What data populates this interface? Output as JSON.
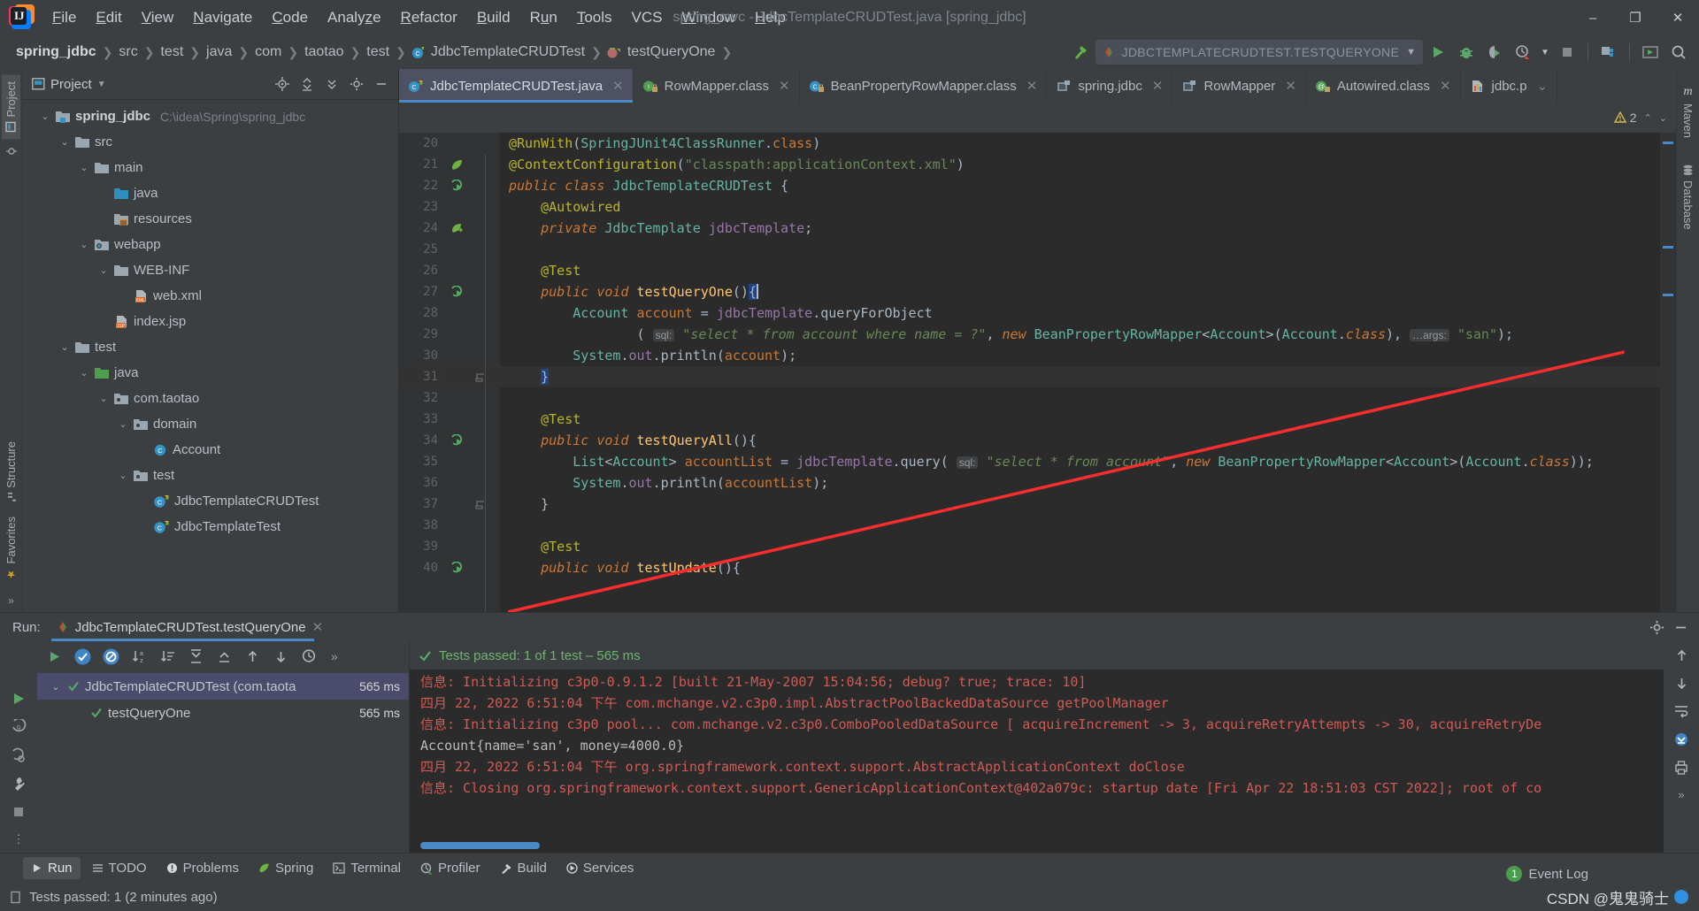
{
  "window": {
    "title": "spring_mvc - JdbcTemplateCRUDTest.java [spring_jdbc]",
    "minimize": "–",
    "maximize": "❐",
    "close": "✕"
  },
  "menu": [
    "File",
    "Edit",
    "View",
    "Navigate",
    "Code",
    "Analyze",
    "Refactor",
    "Build",
    "Run",
    "Tools",
    "VCS",
    "Window",
    "Help"
  ],
  "breadcrumb": [
    {
      "label": "spring_jdbc",
      "bold": true
    },
    {
      "label": "src",
      "bold": false
    },
    {
      "label": "test",
      "bold": false
    },
    {
      "label": "java",
      "bold": false
    },
    {
      "label": "com",
      "bold": false
    },
    {
      "label": "taotao",
      "bold": false
    },
    {
      "label": "test",
      "bold": false
    },
    {
      "label": "JdbcTemplateCRUDTest",
      "bold": false
    },
    {
      "label": "testQueryOne",
      "bold": false
    }
  ],
  "run_config": {
    "name": "JDBCTEMPLATECRUDTEST.TESTQUERYONE"
  },
  "toolbar_icons": [
    "build-hammer-icon",
    "run-icon",
    "debug-icon",
    "run-coverage-icon",
    "profiler-icon",
    "run-dropdown-icon",
    "stop-icon",
    "project-structure-icon",
    "updates-icon",
    "search-everywhere-icon"
  ],
  "project_pane": {
    "title": "Project",
    "actions": [
      "locate-icon",
      "collapse-all-icon",
      "expand-icon",
      "settings-gear-icon",
      "hide-icon"
    ],
    "tree": [
      {
        "depth": 0,
        "arrow": "down",
        "icon": "module-folder",
        "label": "spring_jdbc",
        "bold": true,
        "path": "C:\\idea\\Spring\\spring_jdbc"
      },
      {
        "depth": 1,
        "arrow": "down",
        "icon": "folder",
        "label": "src",
        "bold": false,
        "path": ""
      },
      {
        "depth": 2,
        "arrow": "down",
        "icon": "folder",
        "label": "main",
        "bold": false,
        "path": ""
      },
      {
        "depth": 3,
        "arrow": "none",
        "icon": "source-folder-blue",
        "label": "java",
        "bold": false,
        "path": ""
      },
      {
        "depth": 3,
        "arrow": "none",
        "icon": "resources-folder",
        "label": "resources",
        "bold": false,
        "path": ""
      },
      {
        "depth": 2,
        "arrow": "down",
        "icon": "webapp-folder",
        "label": "webapp",
        "bold": false,
        "path": ""
      },
      {
        "depth": 3,
        "arrow": "down",
        "icon": "folder",
        "label": "WEB-INF",
        "bold": false,
        "path": ""
      },
      {
        "depth": 4,
        "arrow": "none",
        "icon": "xml-file",
        "label": "web.xml",
        "bold": false,
        "path": ""
      },
      {
        "depth": 3,
        "arrow": "none",
        "icon": "jsp-file",
        "label": "index.jsp",
        "bold": false,
        "path": ""
      },
      {
        "depth": 1,
        "arrow": "down",
        "icon": "folder",
        "label": "test",
        "bold": false,
        "path": ""
      },
      {
        "depth": 2,
        "arrow": "down",
        "icon": "test-source-folder-green",
        "label": "java",
        "bold": false,
        "path": ""
      },
      {
        "depth": 3,
        "arrow": "down",
        "icon": "package",
        "label": "com.taotao",
        "bold": false,
        "path": ""
      },
      {
        "depth": 4,
        "arrow": "down",
        "icon": "package",
        "label": "domain",
        "bold": false,
        "path": ""
      },
      {
        "depth": 5,
        "arrow": "none",
        "icon": "class",
        "label": "Account",
        "bold": false,
        "path": ""
      },
      {
        "depth": 4,
        "arrow": "down",
        "icon": "package",
        "label": "test",
        "bold": false,
        "path": ""
      },
      {
        "depth": 5,
        "arrow": "none",
        "icon": "test-class",
        "label": "JdbcTemplateCRUDTest",
        "bold": false,
        "path": ""
      },
      {
        "depth": 5,
        "arrow": "none",
        "icon": "test-class",
        "label": "JdbcTemplateTest",
        "bold": false,
        "path": ""
      }
    ]
  },
  "left_rail": [
    {
      "label": "Project",
      "icon": "project-icon",
      "active": true
    },
    {
      "label": "",
      "icon": "commit-icon",
      "active": false
    }
  ],
  "left_rail_bottom": [
    {
      "label": "Structure",
      "icon": "structure-icon"
    },
    {
      "label": "Favorites",
      "icon": "star-icon"
    }
  ],
  "right_rail": [
    {
      "label": "Maven",
      "icon": "maven-icon"
    },
    {
      "label": "Database",
      "icon": "database-icon"
    }
  ],
  "editor_tabs": [
    {
      "label": "JdbcTemplateCRUDTest.java",
      "icon": "test-class-icon",
      "active": true
    },
    {
      "label": "RowMapper.class",
      "icon": "interface-class-icon",
      "active": false
    },
    {
      "label": "BeanPropertyRowMapper.class",
      "icon": "class-icon",
      "active": false
    },
    {
      "label": "spring.jdbc",
      "icon": "module-icon",
      "active": false
    },
    {
      "label": "RowMapper",
      "icon": "module-icon",
      "active": false
    },
    {
      "label": "Autowired.class",
      "icon": "annotation-class-icon",
      "active": false
    },
    {
      "label": "jdbc.p",
      "icon": "properties-file-icon",
      "active": false
    }
  ],
  "inspection": {
    "warning_count": "2"
  },
  "code": {
    "first_line": 20,
    "lines": [
      {
        "n": 20,
        "gutter": "",
        "cur": false,
        "html": "<span class=\"hl-anno\">@RunWith</span><span class=\"hl-ident\">(</span><span class=\"hl-cls\">SpringJUnit4ClassRunner</span><span class=\"hl-ident\">.</span><span class=\"hl-kw\">class</span><span class=\"hl-ident\">)</span>"
      },
      {
        "n": 21,
        "gutter": "spring-leaf-icon",
        "cur": false,
        "html": "<span class=\"hl-anno\">@ContextConfiguration</span><span class=\"hl-ident\">(</span><span class=\"hl-str\">\"classpath:applicationContext.xml\"</span><span class=\"hl-ident\">)</span>"
      },
      {
        "n": 22,
        "gutter": "run-test-icon",
        "cur": false,
        "html": "<span class=\"hl-kw-i\">public class </span><span class=\"hl-cls\">JdbcTemplateCRUDTest</span><span class=\"hl-ident\"> {</span>"
      },
      {
        "n": 23,
        "gutter": "",
        "cur": false,
        "html": "    <span class=\"hl-anno\">@Autowired</span>"
      },
      {
        "n": 24,
        "gutter": "bean-icon",
        "cur": false,
        "html": "    <span class=\"hl-kw-i\">private </span><span class=\"hl-cls\">JdbcTemplate</span> <span class=\"hl-fld\">jdbcTemplate</span><span class=\"hl-ident\">;</span>"
      },
      {
        "n": 25,
        "gutter": "",
        "cur": false,
        "html": ""
      },
      {
        "n": 26,
        "gutter": "",
        "cur": false,
        "html": "    <span class=\"hl-anno\">@Test</span>"
      },
      {
        "n": 27,
        "gutter": "run-test-icon",
        "cur": false,
        "html": "    <span class=\"hl-kw-i\">public void </span><span class=\"hl-m\">testQueryOne</span><span class=\"hl-ident\">()</span><span class=\"sel\">{</span><span class=\"caret\"></span>"
      },
      {
        "n": 28,
        "gutter": "",
        "cur": false,
        "html": "        <span class=\"hl-cls\">Account</span> <span class=\"hl-local\">account</span> <span class=\"hl-ident\">=</span> <span class=\"hl-fld\">jdbcTemplate</span><span class=\"hl-ident\">.</span><span class=\"hl-ident\">queryForObject</span>"
      },
      {
        "n": 29,
        "gutter": "",
        "cur": false,
        "html": "                <span class=\"hl-ident\">(</span> <span class=\"hint\">sql:</span> <span class=\"hl-str\">\"</span><span class=\"hl-str-i\">select * from account where name = ?</span><span class=\"hl-str\">\"</span><span class=\"hl-ident\">,</span> <span class=\"hl-kw-i\">new </span><span class=\"hl-cls\">BeanPropertyRowMapper</span><span class=\"hl-ident\">&lt;</span><span class=\"hl-cls\">Account</span><span class=\"hl-ident\">&gt;(</span><span class=\"hl-cls\">Account</span><span class=\"hl-ident\">.</span><span class=\"hl-kw-i\">class</span><span class=\"hl-ident\">),</span> <span class=\"hint\">…args:</span> <span class=\"hl-str\">\"san\"</span><span class=\"hl-ident\">);</span>"
      },
      {
        "n": 30,
        "gutter": "",
        "cur": false,
        "html": "        <span class=\"hl-cls\">System</span><span class=\"hl-ident\">.</span><span class=\"hl-fld\">out</span><span class=\"hl-ident\">.</span><span class=\"hl-ident\">println</span><span class=\"hl-ident\">(</span><span class=\"hl-local\">account</span><span class=\"hl-ident\">);</span>"
      },
      {
        "n": 31,
        "gutter": "fold-end-icon",
        "cur": true,
        "html": "    <span class=\"sel\">}</span>"
      },
      {
        "n": 32,
        "gutter": "",
        "cur": false,
        "html": ""
      },
      {
        "n": 33,
        "gutter": "",
        "cur": false,
        "html": "    <span class=\"hl-anno\">@Test</span>"
      },
      {
        "n": 34,
        "gutter": "run-test-icon",
        "cur": false,
        "html": "    <span class=\"hl-kw-i\">public void </span><span class=\"hl-m\">testQueryAll</span><span class=\"hl-ident\">(){</span>"
      },
      {
        "n": 35,
        "gutter": "",
        "cur": false,
        "html": "        <span class=\"hl-cls\">List</span><span class=\"hl-ident\">&lt;</span><span class=\"hl-cls\">Account</span><span class=\"hl-ident\">&gt;</span> <span class=\"hl-local\">accountList</span> <span class=\"hl-ident\">=</span> <span class=\"hl-fld\">jdbcTemplate</span><span class=\"hl-ident\">.</span><span class=\"hl-ident\">query</span><span class=\"hl-ident\">(</span> <span class=\"hint\">sql:</span> <span class=\"hl-str\">\"</span><span class=\"hl-str-i\">select * from account</span><span class=\"hl-str\">\"</span><span class=\"hl-ident\">,</span> <span class=\"hl-kw-i\">new </span><span class=\"hl-cls\">BeanPropertyRowMapper</span><span class=\"hl-ident\">&lt;</span><span class=\"hl-cls\">Account</span><span class=\"hl-ident\">&gt;(</span><span class=\"hl-cls\">Account</span><span class=\"hl-ident\">.</span><span class=\"hl-kw-i\">class</span><span class=\"hl-ident\">));</span>"
      },
      {
        "n": 36,
        "gutter": "",
        "cur": false,
        "html": "        <span class=\"hl-cls\">System</span><span class=\"hl-ident\">.</span><span class=\"hl-fld\">out</span><span class=\"hl-ident\">.</span><span class=\"hl-ident\">println</span><span class=\"hl-ident\">(</span><span class=\"hl-local\">accountList</span><span class=\"hl-ident\">);</span>"
      },
      {
        "n": 37,
        "gutter": "fold-end-icon",
        "cur": false,
        "html": "    <span class=\"hl-ident\">}</span>"
      },
      {
        "n": 38,
        "gutter": "",
        "cur": false,
        "html": ""
      },
      {
        "n": 39,
        "gutter": "",
        "cur": false,
        "html": "    <span class=\"hl-anno\">@Test</span>"
      },
      {
        "n": 40,
        "gutter": "run-test-icon",
        "cur": false,
        "html": "    <span class=\"hl-kw-i\">public void </span><span class=\"hl-m\">testUpdate</span><span class=\"hl-ident\">(){</span>"
      }
    ]
  },
  "run_pane": {
    "label": "Run:",
    "tab_label": "JdbcTemplateCRUDTest.testQueryOne",
    "close": "✕",
    "header_actions": [
      "settings-gear-icon",
      "hide-icon"
    ],
    "toolbar_icons": [
      "rerun-icon",
      "show-passed-icon",
      "show-ignored-icon",
      "sort-alphabetically-icon",
      "sort-by-duration-icon",
      "expand-all-icon",
      "collapse-all-icon",
      "prev-failed-icon",
      "next-failed-icon",
      "test-history-icon",
      "more-icon"
    ],
    "status": "Tests passed: 1 of 1 test – 565 ms",
    "tests": [
      {
        "label": "JdbcTemplateCRUDTest (com.taota",
        "duration": "565 ms",
        "selected": true,
        "depth": 0,
        "arrow": "down"
      },
      {
        "label": "testQueryOne",
        "duration": "565 ms",
        "selected": false,
        "depth": 1,
        "arrow": "none"
      }
    ],
    "console_lines": [
      {
        "type": "err",
        "text": "信息: Initializing c3p0-0.9.1.2 [built 21-May-2007 15:04:56; debug? true; trace: 10]"
      },
      {
        "type": "err",
        "text": "四月 22, 2022 6:51:04 下午 com.mchange.v2.c3p0.impl.AbstractPoolBackedDataSource getPoolManager"
      },
      {
        "type": "err",
        "text": "信息: Initializing c3p0 pool... com.mchange.v2.c3p0.ComboPooledDataSource [ acquireIncrement -> 3, acquireRetryAttempts -> 30, acquireRetryDe"
      },
      {
        "type": "out",
        "text": "Account{name='san', money=4000.0}"
      },
      {
        "type": "err",
        "text": "四月 22, 2022 6:51:04 下午 org.springframework.context.support.AbstractApplicationContext doClose"
      },
      {
        "type": "err",
        "text": "信息: Closing org.springframework.context.support.GenericApplicationContext@402a079c: startup date [Fri Apr 22 18:51:03 CST 2022]; root of co"
      }
    ],
    "rail_icons": [
      "rerun-icon",
      "rerun-failed-icon",
      "wrench-icon",
      "stop-icon",
      "more-vertical-icon"
    ],
    "console_rail_icons": [
      "scroll-up-icon",
      "scroll-down-icon",
      "soft-wrap-icon",
      "scroll-to-end-icon",
      "print-icon",
      "expand-console-icon"
    ]
  },
  "tool_strip": [
    {
      "label": "Run",
      "icon": "run-icon",
      "active": true
    },
    {
      "label": "TODO",
      "icon": "todo-icon",
      "active": false
    },
    {
      "label": "Problems",
      "icon": "problems-icon",
      "active": false
    },
    {
      "label": "Spring",
      "icon": "spring-leaf-icon",
      "active": false
    },
    {
      "label": "Terminal",
      "icon": "terminal-icon",
      "active": false
    },
    {
      "label": "Profiler",
      "icon": "profiler-icon",
      "active": false
    },
    {
      "label": "Build",
      "icon": "build-hammer-icon",
      "active": false
    },
    {
      "label": "Services",
      "icon": "services-icon",
      "active": false
    }
  ],
  "event_log": {
    "count": "1",
    "label": "Event Log"
  },
  "statusbar": {
    "message": "Tests passed: 1 (2 minutes ago)"
  },
  "watermark": {
    "text": "CSDN @鬼鬼骑士"
  },
  "colors": {
    "accent_blue": "#4a88c7",
    "pass_green": "#59a869",
    "error_red": "#cf5b56",
    "annotation_yellow": "#bbb529",
    "string_green": "#6a8759",
    "keyword_orange": "#cc7832",
    "annotation_arrow_red": "#ff2d2d"
  }
}
